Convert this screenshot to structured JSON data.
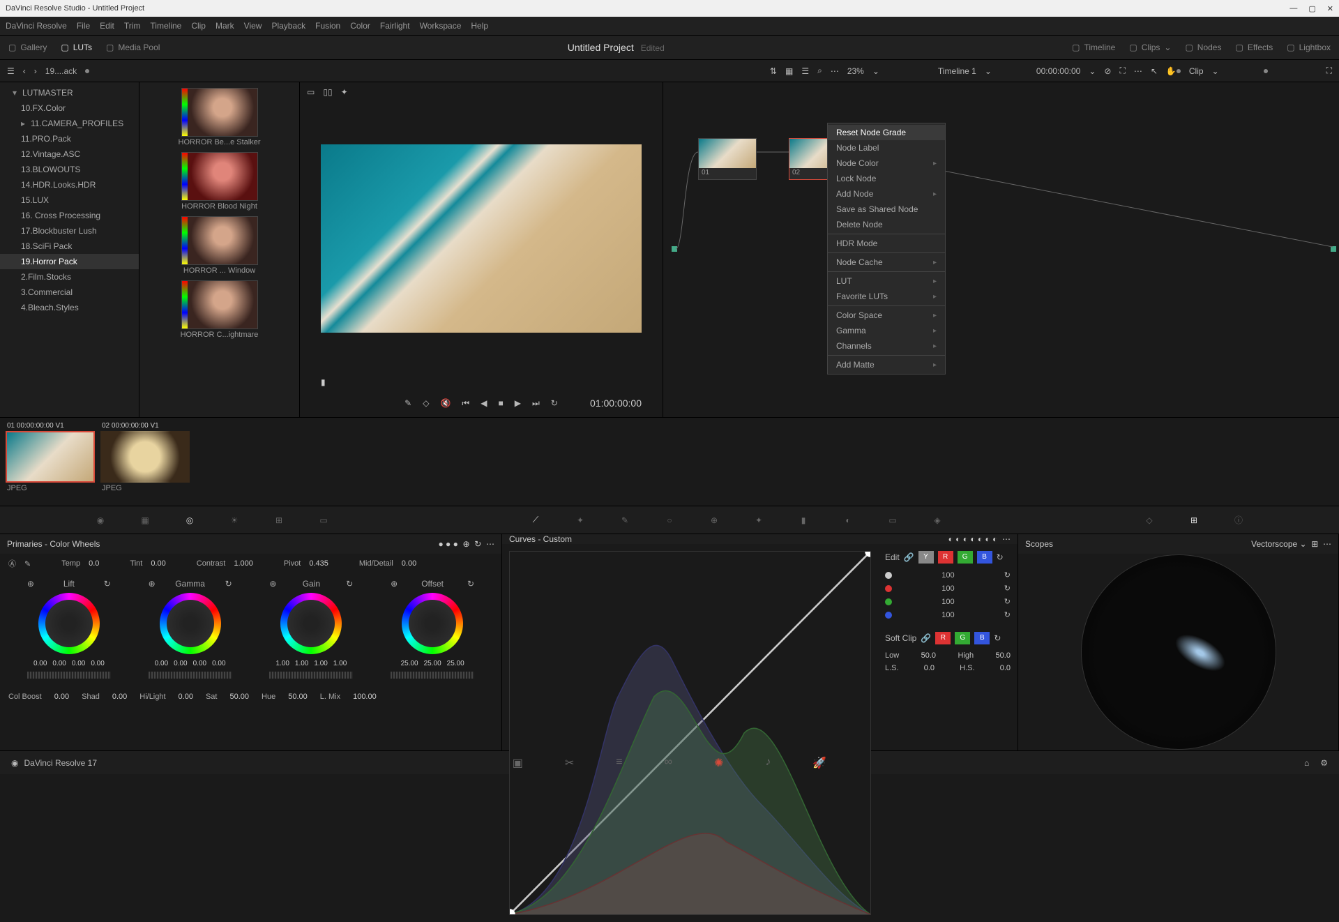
{
  "titlebar": {
    "title": "DaVinci Resolve Studio - Untitled Project"
  },
  "menubar": [
    "DaVinci Resolve",
    "File",
    "Edit",
    "Trim",
    "Timeline",
    "Clip",
    "Mark",
    "View",
    "Playback",
    "Fusion",
    "Color",
    "Fairlight",
    "Workspace",
    "Help"
  ],
  "top_toolbar": {
    "left": [
      {
        "label": "Gallery",
        "icon": "gallery"
      },
      {
        "label": "LUTs",
        "icon": "luts",
        "active": true
      },
      {
        "label": "Media Pool",
        "icon": "media"
      }
    ],
    "project": "Untitled Project",
    "edited": "Edited",
    "right": [
      {
        "label": "Timeline",
        "icon": "timeline"
      },
      {
        "label": "Clips",
        "icon": "clips",
        "dropdown": true
      },
      {
        "label": "Nodes",
        "icon": "nodes"
      },
      {
        "label": "Effects",
        "icon": "effects"
      },
      {
        "label": "Lightbox",
        "icon": "lightbox"
      }
    ]
  },
  "sub_toolbar": {
    "crumb": "19....ack",
    "zoom": "23%",
    "timeline": "Timeline 1",
    "timecode_in": "00:00:00:00",
    "clip_label": "Clip"
  },
  "sidebar": {
    "parent": "LUTMASTER",
    "items": [
      {
        "label": "10.FX.Color"
      },
      {
        "label": "11.CAMERA_PROFILES",
        "expandable": true
      },
      {
        "label": "11.PRO.Pack"
      },
      {
        "label": "12.Vintage.ASC"
      },
      {
        "label": "13.BLOWOUTS"
      },
      {
        "label": "14.HDR.Looks.HDR"
      },
      {
        "label": "15.LUX"
      },
      {
        "label": "16. Cross Processing"
      },
      {
        "label": "17.Blockbuster Lush"
      },
      {
        "label": "18.SciFi Pack"
      },
      {
        "label": "19.Horror Pack",
        "selected": true
      },
      {
        "label": "2.Film.Stocks"
      },
      {
        "label": "3.Commercial"
      },
      {
        "label": "4.Bleach.Styles"
      }
    ]
  },
  "luts": [
    {
      "label": "HORROR Be...e Stalker"
    },
    {
      "label": "HORROR Blood Night",
      "red": true
    },
    {
      "label": "HORROR ... Window"
    },
    {
      "label": "HORROR C...ightmare"
    }
  ],
  "viewer": {
    "timecode": "01:00:00:00"
  },
  "nodes": {
    "n1": "01",
    "n2": "02"
  },
  "context_menu": [
    {
      "label": "Reset Node Grade",
      "hover": true
    },
    {
      "label": "Node Label"
    },
    {
      "label": "Node Color",
      "sub": true
    },
    {
      "label": "Lock Node"
    },
    {
      "label": "Add Node",
      "sub": true
    },
    {
      "label": "Save as Shared Node"
    },
    {
      "label": "Delete Node"
    },
    {
      "sep": true
    },
    {
      "label": "HDR Mode"
    },
    {
      "sep": true
    },
    {
      "label": "Node Cache",
      "sub": true
    },
    {
      "sep": true
    },
    {
      "label": "LUT",
      "sub": true
    },
    {
      "label": "Favorite LUTs",
      "sub": true
    },
    {
      "sep": true
    },
    {
      "label": "Color Space",
      "sub": true
    },
    {
      "label": "Gamma",
      "sub": true
    },
    {
      "label": "Channels",
      "sub": true
    },
    {
      "sep": true
    },
    {
      "label": "Add Matte",
      "sub": true
    }
  ],
  "clips": [
    {
      "header": "01  00:00:00:00    V1",
      "type": "beach",
      "label": "JPEG",
      "selected": true
    },
    {
      "header": "02  00:00:00:00    V1",
      "type": "coffee",
      "label": "JPEG"
    }
  ],
  "primaries": {
    "title": "Primaries - Color Wheels",
    "row1": {
      "temp": "Temp",
      "temp_v": "0.0",
      "tint": "Tint",
      "tint_v": "0.00",
      "contrast": "Contrast",
      "contrast_v": "1.000",
      "pivot": "Pivot",
      "pivot_v": "0.435",
      "mid": "Mid/Detail",
      "mid_v": "0.00"
    },
    "wheels": [
      {
        "name": "Lift",
        "vals": [
          "0.00",
          "0.00",
          "0.00",
          "0.00"
        ]
      },
      {
        "name": "Gamma",
        "vals": [
          "0.00",
          "0.00",
          "0.00",
          "0.00"
        ]
      },
      {
        "name": "Gain",
        "vals": [
          "1.00",
          "1.00",
          "1.00",
          "1.00"
        ]
      },
      {
        "name": "Offset",
        "vals": [
          "25.00",
          "25.00",
          "25.00"
        ]
      }
    ],
    "row2": {
      "colboost": "Col Boost",
      "colboost_v": "0.00",
      "shad": "Shad",
      "shad_v": "0.00",
      "hilight": "Hi/Light",
      "hilight_v": "0.00",
      "sat": "Sat",
      "sat_v": "50.00",
      "hue": "Hue",
      "hue_v": "50.00",
      "lmix": "L. Mix",
      "lmix_v": "100.00"
    }
  },
  "curves": {
    "title": "Curves - Custom",
    "edit": "Edit",
    "vals": [
      {
        "color": "#ccc",
        "v": "100"
      },
      {
        "color": "#d33",
        "v": "100"
      },
      {
        "color": "#3a3",
        "v": "100"
      },
      {
        "color": "#35d",
        "v": "100"
      }
    ],
    "softclip": "Soft Clip",
    "low": "Low",
    "low_v": "50.0",
    "high": "High",
    "high_v": "50.0",
    "ls": "L.S.",
    "ls_v": "0.0",
    "hs": "H.S.",
    "hs_v": "0.0"
  },
  "scopes": {
    "title": "Scopes",
    "type": "Vectorscope"
  },
  "bottom": {
    "version": "DaVinci Resolve 17"
  }
}
